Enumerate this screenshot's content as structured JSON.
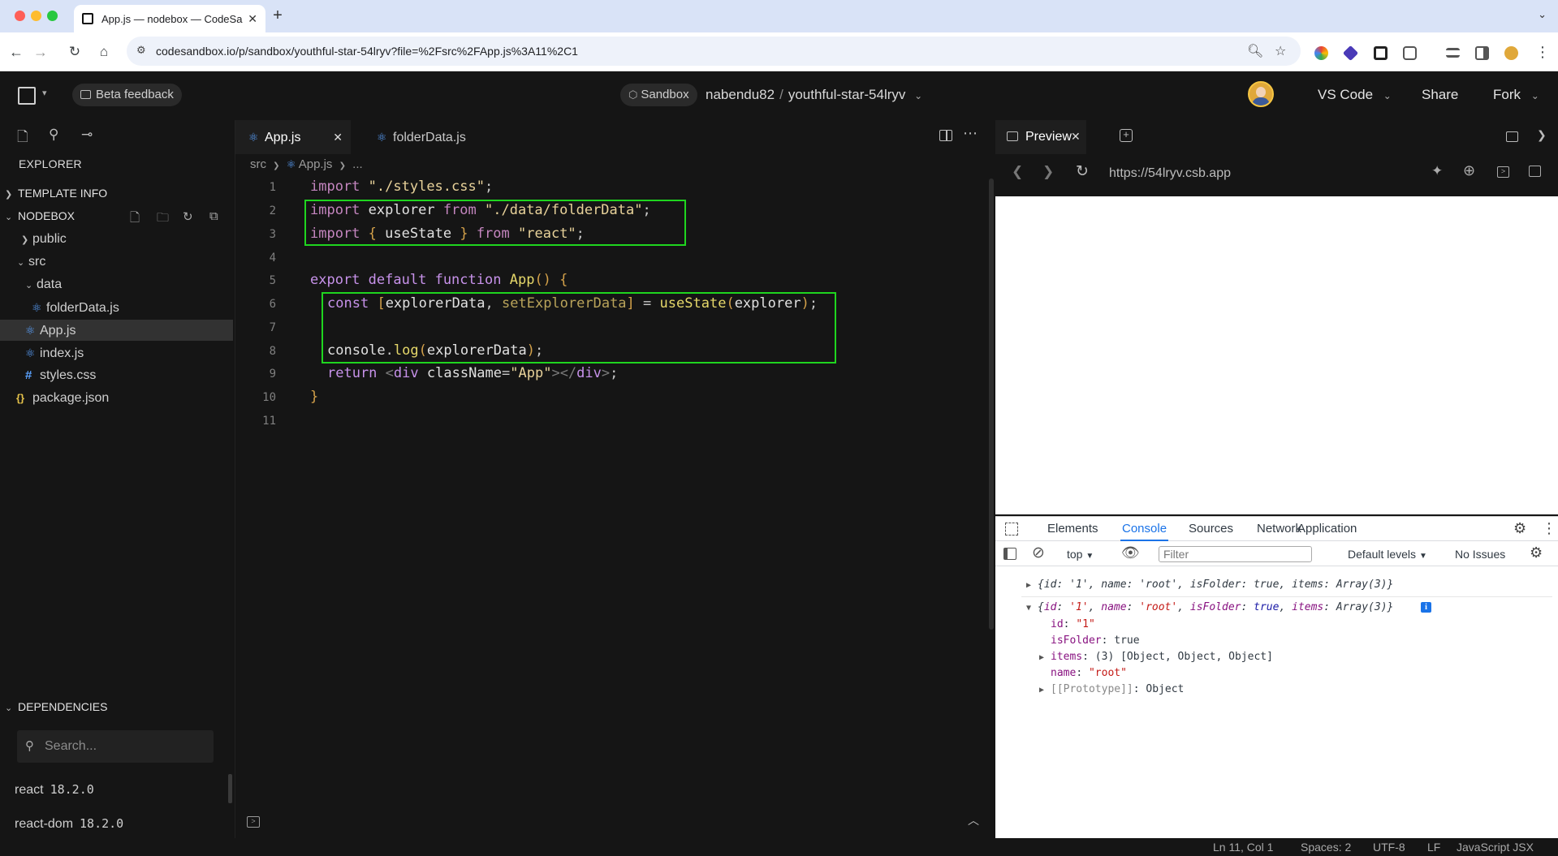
{
  "browser": {
    "tab_title": "App.js — nodebox — CodeSa",
    "url": "codesandbox.io/p/sandbox/youthful-star-54lryv?file=%2Fsrc%2FApp.js%3A11%2C1"
  },
  "header": {
    "beta_feedback": "Beta feedback",
    "sandbox_label": "Sandbox",
    "owner": "nabendu82",
    "separator": "/",
    "project": "youthful-star-54lryv",
    "vscode": "VS Code",
    "share": "Share",
    "fork": "Fork"
  },
  "sidebar": {
    "explorer_title": "EXPLORER",
    "template_info": "TEMPLATE INFO",
    "nodebox": "NODEBOX",
    "tree": {
      "public": "public",
      "src": "src",
      "data": "data",
      "folderData": "folderData.js",
      "app": "App.js",
      "index": "index.js",
      "styles": "styles.css",
      "package": "package.json"
    },
    "dependencies_title": "DEPENDENCIES",
    "search_placeholder": "Search...",
    "dependencies": [
      {
        "name": "react",
        "version": "18.2.0"
      },
      {
        "name": "react-dom",
        "version": "18.2.0"
      }
    ]
  },
  "editor": {
    "tabs": [
      "App.js",
      "folderData.js"
    ],
    "breadcrumb": {
      "folder": "src",
      "file": "App.js",
      "more": "..."
    },
    "line_numbers": [
      "1",
      "2",
      "3",
      "4",
      "5",
      "6",
      "7",
      "8",
      "9",
      "10",
      "11"
    ],
    "code": {
      "l1": {
        "kw": "import",
        "str": "\"./styles.css\"",
        "end": ";"
      },
      "l2": {
        "kw": "import",
        "name": "explorer",
        "from": "from",
        "str": "\"./data/folderData\"",
        "end": ";"
      },
      "l3": {
        "kw": "import",
        "ob": "{",
        "name": "useState",
        "cb": "}",
        "from": "from",
        "str": "\"react\"",
        "end": ";"
      },
      "l5": {
        "kw1": "export",
        "kw2": "default",
        "kw3": "function",
        "fn": "App",
        "paren": "()",
        "brace": "{"
      },
      "l6": {
        "kw": "const",
        "ob": "[",
        "a": "explorerData",
        "comma": ",",
        "b": "setExplorerData",
        "cb": "]",
        "eq": "=",
        "fn": "useState",
        "op": "(",
        "arg": "explorer",
        "cp": ")",
        "end": ";"
      },
      "l8": {
        "obj": "console",
        "dot": ".",
        "fn": "log",
        "op": "(",
        "arg": "explorerData",
        "cp": ")",
        "end": ";"
      },
      "l9": {
        "kw": "return",
        "lt": "<",
        "tag": "div",
        "attr": "className",
        "eq": "=",
        "str": "\"App\"",
        "close": "></",
        "tag2": "div",
        "gt": ">",
        "end": ";"
      },
      "l10": {
        "brace": "}"
      }
    }
  },
  "preview": {
    "tab": "Preview",
    "url": "https://54lryv.csb.app"
  },
  "devtools": {
    "tabs": [
      "Elements",
      "Console",
      "Sources",
      "Network",
      "Application"
    ],
    "context": "top",
    "filter_placeholder": "Filter",
    "levels": "Default levels",
    "issues": "No Issues",
    "log_summary": "{id: '1', name: 'root', isFolder: true, items: Array(3)}",
    "log_prefix": "{",
    "log_k_id": "id",
    "log_v_id": "'1'",
    "log_k_name": "name",
    "log_v_name": "'root'",
    "log_k_isFolder": "isFolder",
    "log_v_isFolder": "true",
    "log_k_items": "items",
    "log_v_items": "Array(3)}",
    "info_badge": "i",
    "expanded": {
      "id_key": "id",
      "id_val": "\"1\"",
      "isFolder_key": "isFolder",
      "isFolder_val": "true",
      "items_key": "items",
      "items_val": "(3) [Object, Object, Object]",
      "name_key": "name",
      "name_val": "\"root\"",
      "proto_key": "[[Prototype]]",
      "proto_val": "Object"
    }
  },
  "statusbar": {
    "position": "Ln 11, Col 1",
    "spaces": "Spaces: 2",
    "encoding": "UTF-8",
    "eol": "LF",
    "language": "JavaScript JSX"
  },
  "colors": {
    "highlight_box": "#1fd51f",
    "accent_blue": "#1a73e8"
  }
}
